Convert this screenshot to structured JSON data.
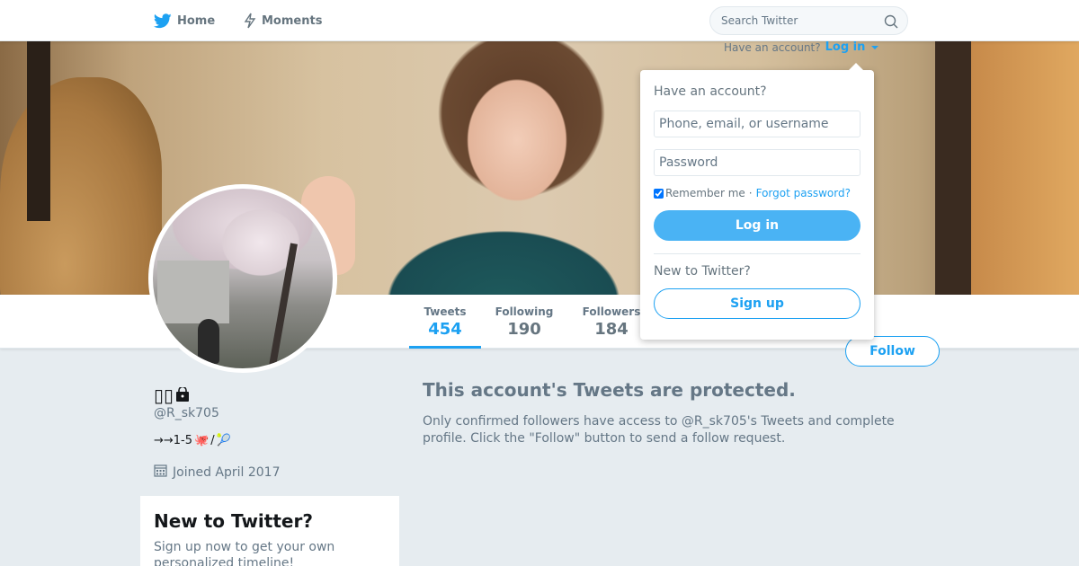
{
  "nav": {
    "home_label": "Home",
    "moments_label": "Moments",
    "search_placeholder": "Search Twitter",
    "brand_color": "#1da1f2"
  },
  "login_prompt": {
    "have_account": "Have an account?",
    "login_link": "Log in"
  },
  "login_dropdown": {
    "title": "Have an account?",
    "username_placeholder": "Phone, email, or username",
    "password_placeholder": "Password",
    "remember_me": "Remember me",
    "separator": "·",
    "forgot_password": "Forgot password?",
    "login_button": "Log in",
    "new_to_twitter": "New to Twitter?",
    "signup_button": "Sign up"
  },
  "profile": {
    "display_name_glyphs": "▯▯",
    "handle": "@R_sk705",
    "bio_text": "→→1-5",
    "bio_emoji_1": "🐙",
    "bio_slash": "/",
    "bio_emoji_2": "🎾",
    "joined": "Joined April 2017",
    "icons": [
      "lock-icon",
      "calendar-icon"
    ]
  },
  "stats": [
    {
      "label": "Tweets",
      "value": "454",
      "active": true
    },
    {
      "label": "Following",
      "value": "190",
      "active": false
    },
    {
      "label": "Followers",
      "value": "184",
      "active": false
    }
  ],
  "follow_button": "Follow",
  "protected": {
    "title": "This account's Tweets are protected.",
    "body": "Only confirmed followers have access to @R_sk705's Tweets and complete profile. Click the \"Follow\" button to send a follow request."
  },
  "new_to_twitter_box": {
    "title": "New to Twitter?",
    "body": "Sign up now to get your own personalized timeline!"
  }
}
